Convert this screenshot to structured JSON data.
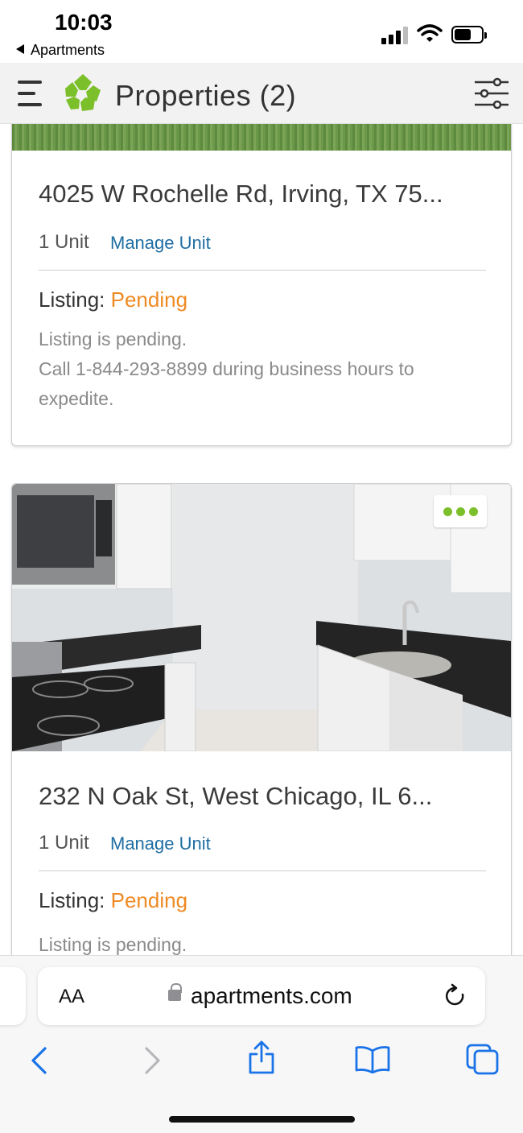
{
  "status_bar": {
    "time": "10:03",
    "back_label": "Apartments"
  },
  "header": {
    "title": "Properties (2)",
    "logo_color": "#7bbf2a"
  },
  "properties": [
    {
      "address": "4025 W Rochelle Rd, Irving, TX 75...",
      "units": "1 Unit",
      "manage_label": "Manage Unit",
      "listing_label": "Listing:",
      "listing_status": "Pending",
      "description_line1": "Listing is pending.",
      "description_line2": "Call 1-844-293-8899 during business hours to expedite."
    },
    {
      "address": "232 N Oak St, West Chicago, IL 6...",
      "units": "1 Unit",
      "manage_label": "Manage Unit",
      "listing_label": "Listing:",
      "listing_status": "Pending",
      "description_line1": "Listing is pending."
    }
  ],
  "browser": {
    "text_size_label": "AA",
    "url": "apartments.com"
  },
  "colors": {
    "accent_link": "#1f6ea3",
    "pending": "#ef8a23",
    "more_dots": "#7bbf2a",
    "browser_tint": "#1a73e8"
  }
}
